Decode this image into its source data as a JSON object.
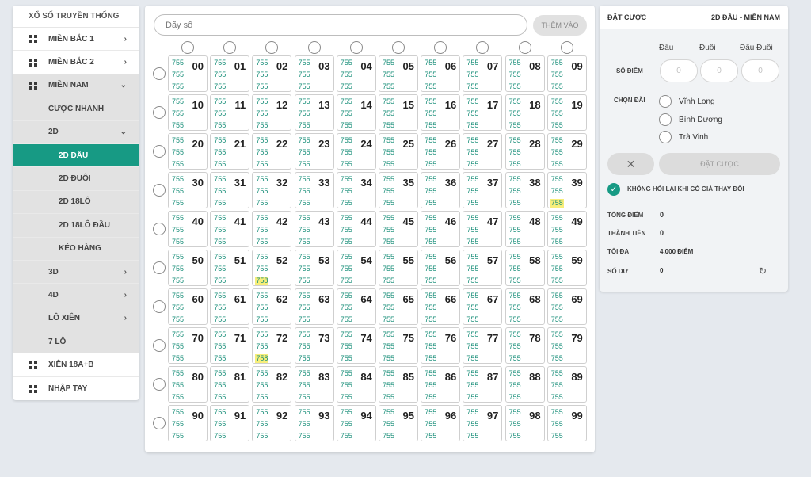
{
  "sidebar": {
    "title": "XỔ SỐ TRUYỀN THỐNG",
    "items": [
      {
        "label": "MIỀN BẮC 1",
        "icon": "grid-icon",
        "chevron": "›"
      },
      {
        "label": "MIỀN BẮC 2",
        "icon": "grid-icon",
        "chevron": "›"
      },
      {
        "label": "MIỀN NAM",
        "icon": "grid-icon",
        "chevron": "⌄"
      },
      {
        "label": "CƯỢC NHANH"
      },
      {
        "label": "2D",
        "chevron": "⌄"
      },
      {
        "label": "2D ĐẦU"
      },
      {
        "label": "2D ĐUÔI"
      },
      {
        "label": "2D 18LÔ"
      },
      {
        "label": "2D 18LÔ ĐẦU"
      },
      {
        "label": "KÉO HÀNG"
      },
      {
        "label": "3D",
        "chevron": "›"
      },
      {
        "label": "4D",
        "chevron": "›"
      },
      {
        "label": "LÔ XIÊN",
        "chevron": "›"
      },
      {
        "label": "7 LÔ"
      },
      {
        "label": "XIÊN 18A+B",
        "icon": "grid-icon"
      },
      {
        "label": "NHẬP TAY",
        "icon": "grid-icon"
      }
    ]
  },
  "main": {
    "search_placeholder": "Dãy số",
    "add_button": "THÊM VÀO",
    "default_price": "755",
    "highlight_color": "#f7ee7a",
    "price_color": "#1a8f7a",
    "numbers": [
      "00",
      "01",
      "02",
      "03",
      "04",
      "05",
      "06",
      "07",
      "08",
      "09",
      "10",
      "11",
      "12",
      "13",
      "14",
      "15",
      "16",
      "17",
      "18",
      "19",
      "20",
      "21",
      "22",
      "23",
      "24",
      "25",
      "26",
      "27",
      "28",
      "29",
      "30",
      "31",
      "32",
      "33",
      "34",
      "35",
      "36",
      "37",
      "38",
      "39",
      "40",
      "41",
      "42",
      "43",
      "44",
      "45",
      "46",
      "47",
      "48",
      "49",
      "50",
      "51",
      "52",
      "53",
      "54",
      "55",
      "56",
      "57",
      "58",
      "59",
      "60",
      "61",
      "62",
      "63",
      "64",
      "65",
      "66",
      "67",
      "68",
      "69",
      "70",
      "71",
      "72",
      "73",
      "74",
      "75",
      "76",
      "77",
      "78",
      "79",
      "80",
      "81",
      "82",
      "83",
      "84",
      "85",
      "86",
      "87",
      "88",
      "89",
      "90",
      "91",
      "92",
      "93",
      "94",
      "95",
      "96",
      "97",
      "98",
      "99"
    ],
    "overrides": [
      {
        "number": "39",
        "line": 2,
        "value": "758",
        "highlight": true
      },
      {
        "number": "52",
        "line": 2,
        "value": "758",
        "highlight": true
      },
      {
        "number": "72",
        "line": 2,
        "value": "758",
        "highlight": true
      }
    ]
  },
  "bet_panel": {
    "title": "ĐẶT CƯỢC",
    "subtitle": "2D ĐẦU - MIỀN NAM",
    "col_head": "Đầu",
    "col_tail": "Đuôi",
    "col_both": "Đầu Đuôi",
    "points_label": "SỐ ĐIỂM",
    "points_placeholder": "0",
    "station_label": "CHỌN ĐÀI",
    "stations": [
      "Vĩnh Long",
      "Bình Dương",
      "Trà Vinh"
    ],
    "cancel_icon": "close-icon",
    "bet_button": "ĐẶT CƯỢC",
    "no_ask_label": "KHÔNG HỎI LẠI KHI CÓ GIÁ THAY ĐỔI",
    "accent_color": "#179a84",
    "total_points_label": "TỔNG ĐIỂM",
    "total_points": "0",
    "amount_label": "THÀNH TIỀN",
    "amount": "0",
    "max_label": "TỐI ĐA",
    "max_value": "4,000 ĐIỂM",
    "balance_label": "SỐ DƯ",
    "balance": "0"
  }
}
